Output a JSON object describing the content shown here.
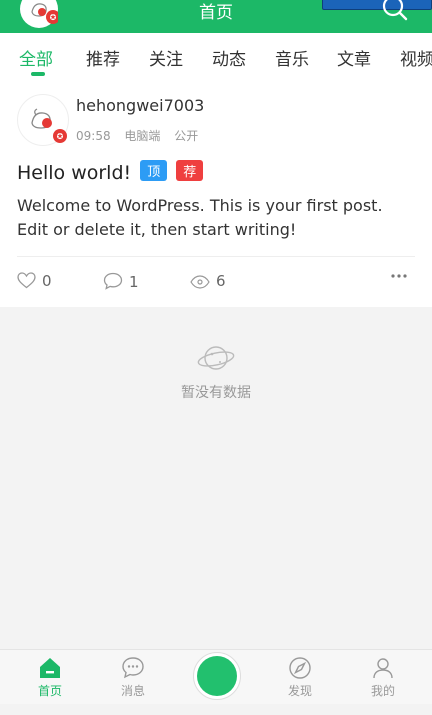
{
  "header": {
    "title": "首页"
  },
  "tabs": [
    {
      "label": "全部",
      "active": true
    },
    {
      "label": "推荐"
    },
    {
      "label": "关注"
    },
    {
      "label": "动态"
    },
    {
      "label": "音乐"
    },
    {
      "label": "文章"
    },
    {
      "label": "视频"
    }
  ],
  "post": {
    "author": "hehongwei7003",
    "time": "09:58",
    "device": "电脑端",
    "visibility": "公开",
    "title": "Hello world!",
    "badge_top": "顶",
    "badge_recommend": "荐",
    "excerpt": "Welcome to WordPress. This is your first post. Edit or delete it, then start writing!",
    "likes": "0",
    "comments": "1",
    "views": "6"
  },
  "empty_state": {
    "text": "暂没有数据"
  },
  "bottom_nav": {
    "home": "首页",
    "messages": "消息",
    "discover": "发现",
    "me": "我的"
  },
  "colors": {
    "accent": "#1cb867",
    "badge_top": "#2d9cf5",
    "badge_recommend": "#ef3f3f",
    "user_chip": "#1b64b9"
  }
}
